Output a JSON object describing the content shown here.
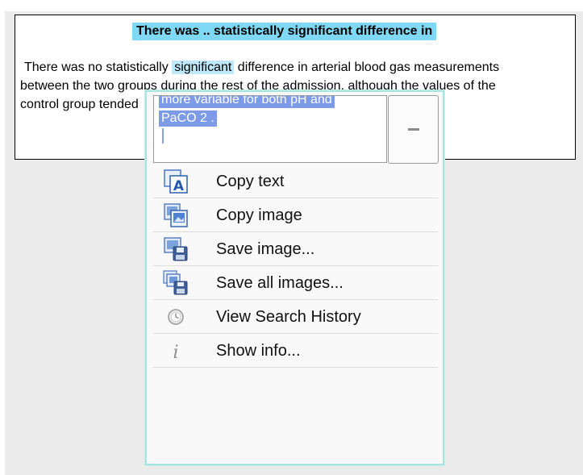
{
  "document": {
    "title": "There was .. statistically significant difference in",
    "line1_before": "There was no statistically ",
    "line1_highlight": "significant",
    "line1_after": " difference in arterial blood gas measurements",
    "line2": "between the two groups during the rest of the admission, although the values of the",
    "line3": "control group tended"
  },
  "context_menu": {
    "preview_line1": "more variable for both pH and",
    "preview_line2": "PaCO 2 .",
    "collapse_label": "–",
    "items": [
      {
        "label": "Copy text",
        "icon": "copy-text-icon"
      },
      {
        "label": "Copy image",
        "icon": "copy-image-icon"
      },
      {
        "label": "Save image...",
        "icon": "save-image-icon"
      },
      {
        "label": "Save all images...",
        "icon": "save-all-images-icon"
      },
      {
        "label": "View Search History",
        "icon": "history-icon"
      },
      {
        "label": "Show info...",
        "icon": "info-icon"
      }
    ]
  },
  "colors": {
    "title_highlight": "#7fd8f6",
    "word_highlight": "#bfe9fb",
    "selection": "#7e9be8",
    "menu_border": "#a6e4dd"
  }
}
